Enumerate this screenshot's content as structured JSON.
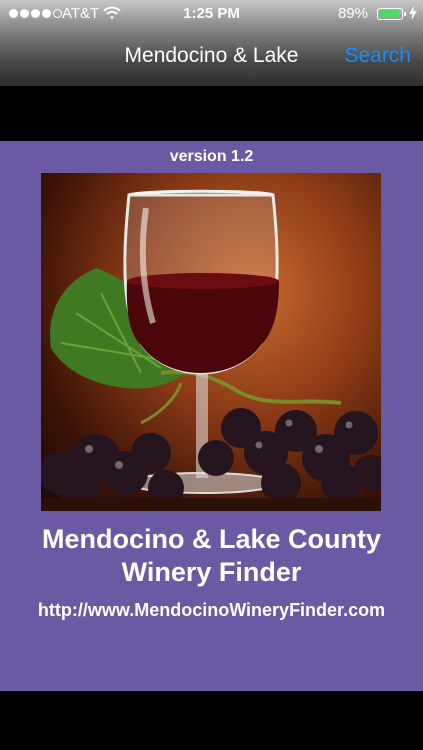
{
  "status_bar": {
    "carrier": "AT&T",
    "time": "1:25 PM",
    "battery_percent": "89%",
    "battery_level": 0.89,
    "signal_bars": 4,
    "signal_total": 5
  },
  "nav_bar": {
    "title": "Mendocino & Lake",
    "search_label": "Search"
  },
  "splash": {
    "version": "version 1.2",
    "title_line1": "Mendocino & Lake County",
    "title_line2": "Winery Finder",
    "url": "http://www.MendocinoWineryFinder.com"
  },
  "colors": {
    "panel_background": "#6b5aa3",
    "nav_link": "#1a8cff",
    "battery_fill": "#4cd964"
  }
}
